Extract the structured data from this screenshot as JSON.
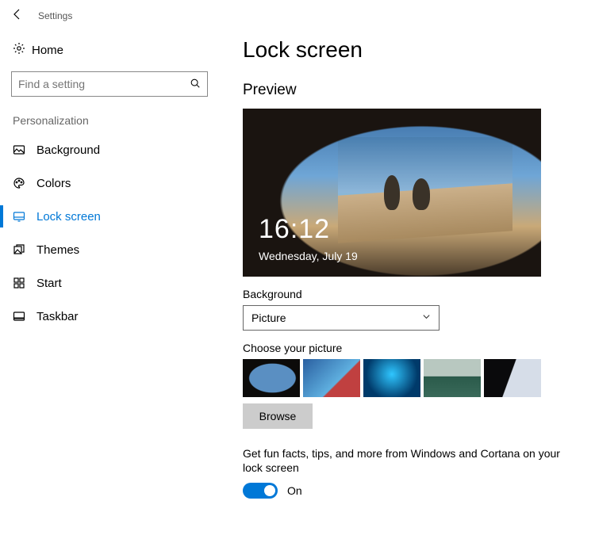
{
  "header": {
    "title": "Settings"
  },
  "sidebar": {
    "home_label": "Home",
    "search_placeholder": "Find a setting",
    "section_label": "Personalization",
    "items": [
      {
        "label": "Background"
      },
      {
        "label": "Colors"
      },
      {
        "label": "Lock screen"
      },
      {
        "label": "Themes"
      },
      {
        "label": "Start"
      },
      {
        "label": "Taskbar"
      }
    ]
  },
  "main": {
    "title": "Lock screen",
    "preview_label": "Preview",
    "preview": {
      "time": "16:12",
      "date": "Wednesday, July 19"
    },
    "background_label": "Background",
    "background_selected": "Picture",
    "choose_label": "Choose your picture",
    "browse_label": "Browse",
    "tips_label": "Get fun facts, tips, and more from Windows and Cortana on your lock screen",
    "toggle_state": "On"
  }
}
